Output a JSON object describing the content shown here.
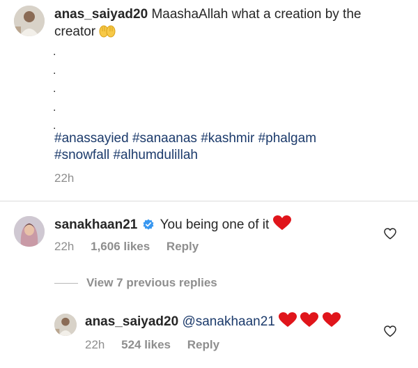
{
  "post_caption": {
    "username": "anas_saiyad20",
    "text": "MaashaAllah what a creation by the creator",
    "emoji_icon": "raising-hands-icon",
    "dots": [
      ".",
      ".",
      ".",
      ".",
      "."
    ],
    "hashtags_line1": "#anassayied #sanaanas #kashmir #phalgam",
    "hashtags_line2": "#snowfall #alhumdulillah",
    "time": "22h"
  },
  "comment": {
    "username": "sanakhaan21",
    "verified_icon": "verified-badge-icon",
    "text": "You being one of it",
    "emoji_icon": "red-heart-icon",
    "time": "22h",
    "likes": "1,606 likes",
    "reply_label": "Reply"
  },
  "view_replies_label": "View 7 previous replies",
  "reply": {
    "username": "anas_saiyad20",
    "mention": "@sanakhaan21",
    "emoji_icons": [
      "red-heart-icon",
      "red-heart-icon",
      "red-heart-icon"
    ],
    "time": "22h",
    "likes": "524 likes",
    "reply_label": "Reply"
  },
  "colors": {
    "hashtag": "#1b3a6b",
    "meta_gray": "#8e8e8e",
    "heart_red": "#e0151b",
    "verified_blue": "#3897f0"
  }
}
